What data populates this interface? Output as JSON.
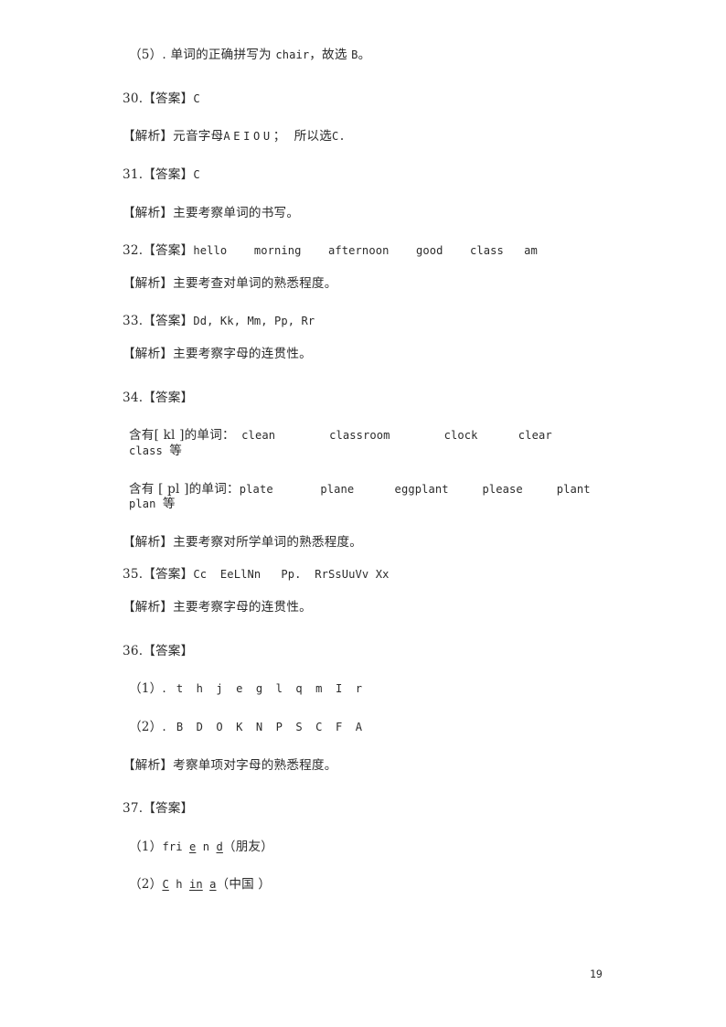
{
  "document": {
    "page_number": "19",
    "blocks": [
      {
        "id": "item-5-explanation",
        "name": "explanation-line-5",
        "indent": true,
        "spacing": "loose",
        "runs": [
          {
            "style": "cn",
            "text": "（5）. 单词的正确拼写为 "
          },
          {
            "style": "en",
            "text": "chair"
          },
          {
            "style": "cn",
            "text": "，故选 "
          },
          {
            "style": "en",
            "text": "B"
          },
          {
            "style": "cn",
            "text": "。"
          }
        ]
      },
      {
        "id": "q30-answer",
        "name": "question-30-answer",
        "spacing": "normal",
        "runs": [
          {
            "style": "cn",
            "text": "30.【答案】"
          },
          {
            "style": "en",
            "text": "C"
          }
        ]
      },
      {
        "id": "q30-explanation",
        "name": "question-30-explanation",
        "spacing": "normal",
        "runs": [
          {
            "style": "cn",
            "text": "【解析】元音字母"
          },
          {
            "style": "spaced",
            "text": "AEIOU"
          },
          {
            "style": "cn",
            "text": "；  所以选"
          },
          {
            "style": "en",
            "text": "C."
          }
        ]
      },
      {
        "id": "q31-answer",
        "name": "question-31-answer",
        "spacing": "normal",
        "runs": [
          {
            "style": "cn",
            "text": "31.【答案】"
          },
          {
            "style": "en",
            "text": "C"
          }
        ]
      },
      {
        "id": "q31-explanation",
        "name": "question-31-explanation",
        "spacing": "normal",
        "runs": [
          {
            "style": "cn",
            "text": "【解析】主要考察单词的书写。"
          }
        ]
      },
      {
        "id": "q32-answer",
        "name": "question-32-answer",
        "spacing": "tight",
        "runs": [
          {
            "style": "cn",
            "text": "32.【答案】"
          },
          {
            "style": "en",
            "text": "hello    morning    afternoon    good    class   am"
          }
        ]
      },
      {
        "id": "q32-explanation",
        "name": "question-32-explanation",
        "spacing": "normal",
        "runs": [
          {
            "style": "cn",
            "text": "【解析】主要考查对单词的熟悉程度。"
          }
        ]
      },
      {
        "id": "q33-answer",
        "name": "question-33-answer",
        "spacing": "tight",
        "runs": [
          {
            "style": "cn",
            "text": "33.【答案】"
          },
          {
            "style": "en",
            "text": "Dd, Kk, Mm, Pp, Rr"
          }
        ]
      },
      {
        "id": "q33-explanation",
        "name": "question-33-explanation",
        "spacing": "loose",
        "runs": [
          {
            "style": "cn",
            "text": "【解析】主要考察字母的连贯性。"
          }
        ]
      },
      {
        "id": "q34-answer",
        "name": "question-34-answer",
        "spacing": "normal",
        "runs": [
          {
            "style": "cn",
            "text": "34.【答案】"
          }
        ]
      },
      {
        "id": "q34-kl-words",
        "name": "question-34-kl-words",
        "indent": true,
        "spacing": "normal",
        "runs": [
          {
            "style": "cn",
            "text": "含有[ kl ]的单词："
          },
          {
            "style": "en",
            "text": " clean        classroom        clock      clear       class "
          },
          {
            "style": "cn",
            "text": "等"
          }
        ]
      },
      {
        "id": "q34-pl-words",
        "name": "question-34-pl-words",
        "indent": true,
        "spacing": "normal",
        "runs": [
          {
            "style": "cn",
            "text": "含有 [ pl ]的单词："
          },
          {
            "style": "en",
            "text": "plate       plane      eggplant     please     plant     plan "
          },
          {
            "style": "cn",
            "text": "等"
          }
        ]
      },
      {
        "id": "q34-explanation",
        "name": "question-34-explanation",
        "spacing": "tight",
        "runs": [
          {
            "style": "cn",
            "text": "【解析】主要考察对所学单词的熟悉程度。"
          }
        ]
      },
      {
        "id": "q35-answer",
        "name": "question-35-answer",
        "spacing": "tight",
        "runs": [
          {
            "style": "cn",
            "text": "35.【答案】"
          },
          {
            "style": "en",
            "text": "Cc  EeLlNn   Pp.  RrSsUuVv Xx"
          }
        ]
      },
      {
        "id": "q35-explanation",
        "name": "question-35-explanation",
        "spacing": "loose",
        "runs": [
          {
            "style": "cn",
            "text": "【解析】主要考察字母的连贯性。"
          }
        ]
      },
      {
        "id": "q36-answer",
        "name": "question-36-answer",
        "spacing": "normal",
        "runs": [
          {
            "style": "cn",
            "text": "36.【答案】"
          }
        ]
      },
      {
        "id": "q36-part1",
        "name": "question-36-part-1",
        "indent": true,
        "spacing": "normal",
        "runs": [
          {
            "style": "cn",
            "text": "（1）."
          },
          {
            "style": "spaced",
            "text": " t h j e g l q m I r"
          }
        ]
      },
      {
        "id": "q36-part2",
        "name": "question-36-part-2",
        "indent": true,
        "spacing": "normal",
        "runs": [
          {
            "style": "cn",
            "text": "（2）."
          },
          {
            "style": "spaced",
            "text": " B D O K N P S C F A"
          }
        ]
      },
      {
        "id": "q36-explanation",
        "name": "question-36-explanation",
        "spacing": "loose",
        "runs": [
          {
            "style": "cn",
            "text": "【解析】考察单项对字母的熟悉程度。"
          }
        ]
      },
      {
        "id": "q37-answer",
        "name": "question-37-answer",
        "spacing": "normal",
        "runs": [
          {
            "style": "cn",
            "text": "37.【答案】"
          }
        ]
      },
      {
        "id": "q37-part1",
        "name": "question-37-part-1",
        "indent": true,
        "spacing": "normal",
        "runs": [
          {
            "style": "cn",
            "text": "（1）"
          },
          {
            "style": "en",
            "text": "fri "
          },
          {
            "style": "en-underline",
            "text": "e"
          },
          {
            "style": "en",
            "text": " n "
          },
          {
            "style": "en-underline",
            "text": "d"
          },
          {
            "style": "cn",
            "text": "（朋友）"
          }
        ]
      },
      {
        "id": "q37-part2",
        "name": "question-37-part-2",
        "indent": true,
        "spacing": "normal",
        "runs": [
          {
            "style": "cn",
            "text": "（2）"
          },
          {
            "style": "en-underline",
            "text": "C"
          },
          {
            "style": "en",
            "text": " h "
          },
          {
            "style": "en-underline",
            "text": "in"
          },
          {
            "style": "en",
            "text": " "
          },
          {
            "style": "en-underline",
            "text": "a"
          },
          {
            "style": "cn",
            "text": "（中国 ）"
          }
        ]
      }
    ]
  }
}
